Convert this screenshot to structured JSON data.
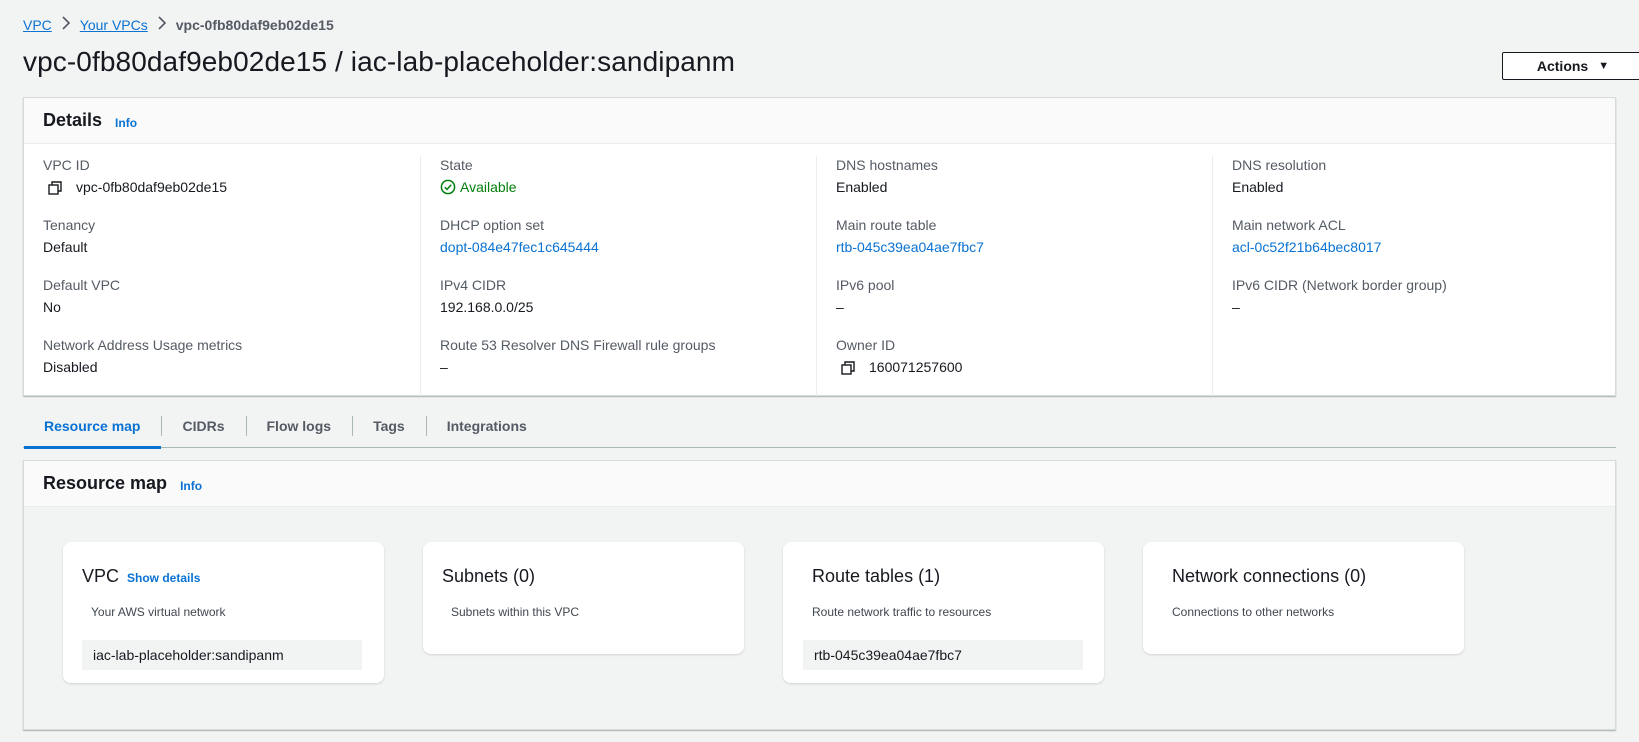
{
  "breadcrumb": {
    "items": [
      "VPC",
      "Your VPCs"
    ],
    "current": "vpc-0fb80daf9eb02de15",
    "separator": ">"
  },
  "page": {
    "title": "vpc-0fb80daf9eb02de15 / iac-lab-placeholder:sandipanm",
    "actions_label": "Actions"
  },
  "details": {
    "title": "Details",
    "info": "Info",
    "columns": [
      [
        {
          "label": "VPC ID",
          "value": "vpc-0fb80daf9eb02de15",
          "copy": true
        },
        {
          "label": "Tenancy",
          "value": "Default"
        },
        {
          "label": "Default VPC",
          "value": "No"
        },
        {
          "label": "Network Address Usage metrics",
          "value": "Disabled"
        }
      ],
      [
        {
          "label": "State",
          "value": "Available",
          "status": "success"
        },
        {
          "label": "DHCP option set",
          "value": "dopt-084e47fec1c645444",
          "link": true
        },
        {
          "label": "IPv4 CIDR",
          "value": "192.168.0.0/25"
        },
        {
          "label": "Route 53 Resolver DNS Firewall rule groups",
          "value": "–"
        }
      ],
      [
        {
          "label": "DNS hostnames",
          "value": "Enabled"
        },
        {
          "label": "Main route table",
          "value": "rtb-045c39ea04ae7fbc7",
          "link": true
        },
        {
          "label": "IPv6 pool",
          "value": "–"
        },
        {
          "label": "Owner ID",
          "value": "160071257600",
          "copy": true
        }
      ],
      [
        {
          "label": "DNS resolution",
          "value": "Enabled"
        },
        {
          "label": "Main network ACL",
          "value": "acl-0c52f21b64bec8017",
          "link": true
        },
        {
          "label": "IPv6 CIDR (Network border group)",
          "value": "–"
        }
      ]
    ]
  },
  "tabs": [
    "Resource map",
    "CIDRs",
    "Flow logs",
    "Tags",
    "Integrations"
  ],
  "active_tab": "Resource map",
  "resource_map": {
    "title": "Resource map",
    "info": "Info",
    "cards": [
      {
        "title": "VPC",
        "link": "Show details",
        "subtitle": "Your AWS virtual network",
        "chip": "iac-lab-placeholder:sandipanm"
      },
      {
        "title": "Subnets (0)",
        "subtitle": "Subnets within this VPC"
      },
      {
        "title": "Route tables (1)",
        "subtitle": "Route network traffic to resources",
        "chip": "rtb-045c39ea04ae7fbc7"
      },
      {
        "title": "Network connections (0)",
        "subtitle": "Connections to other networks"
      }
    ]
  },
  "colors": {
    "link": "#0972d3",
    "success": "#037f0c",
    "background": "#f2f3f3"
  }
}
